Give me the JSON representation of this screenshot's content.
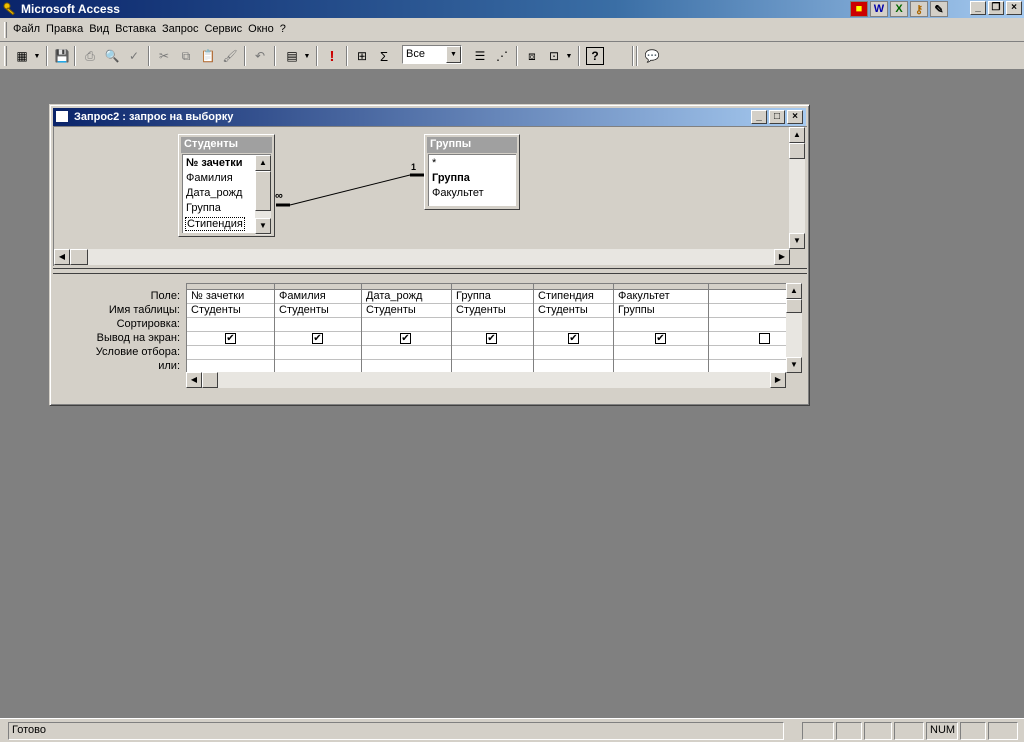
{
  "app": {
    "title": "Microsoft Access"
  },
  "menu": [
    "Файл",
    "Правка",
    "Вид",
    "Вставка",
    "Запрос",
    "Сервис",
    "Окно",
    "?"
  ],
  "toolbar": {
    "top_values": "Все",
    "totals_symbol": "Σ",
    "run_symbol": "!",
    "help_symbol": "?"
  },
  "query_window": {
    "title": "Запрос2 : запрос на выборку",
    "tables": [
      {
        "name": "Студенты",
        "fields": [
          "№ зачетки",
          "Фамилия",
          "Дата_рожд",
          "Группа",
          "Стипендия"
        ]
      },
      {
        "name": "Группы",
        "fields": [
          "*",
          "Группа",
          "Факультет"
        ]
      }
    ],
    "join": {
      "many_label": "∞",
      "one_label": "1"
    },
    "row_labels": [
      "Поле:",
      "Имя таблицы:",
      "Сортировка:",
      "Вывод на экран:",
      "Условие отбора:",
      "или:"
    ],
    "columns": [
      {
        "field": "№ зачетки",
        "table": "Студенты",
        "show": true
      },
      {
        "field": "Фамилия",
        "table": "Студенты",
        "show": true
      },
      {
        "field": "Дата_рожд",
        "table": "Студенты",
        "show": true
      },
      {
        "field": "Группа",
        "table": "Студенты",
        "show": true
      },
      {
        "field": "Стипендия",
        "table": "Студенты",
        "show": true
      },
      {
        "field": "Факультет",
        "table": "Группы",
        "show": true
      },
      {
        "field": "",
        "table": "",
        "show": false
      }
    ]
  },
  "status": {
    "text": "Готово",
    "num": "NUM"
  }
}
